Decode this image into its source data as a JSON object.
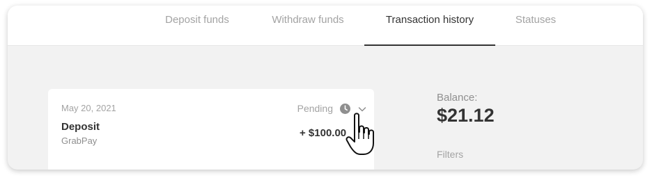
{
  "tabs": [
    {
      "label": "Deposit funds",
      "active": false
    },
    {
      "label": "Withdraw funds",
      "active": false
    },
    {
      "label": "Transaction history",
      "active": true
    },
    {
      "label": "Statuses",
      "active": false
    }
  ],
  "transaction": {
    "date": "May 20, 2021",
    "status": "Pending",
    "status_icon": "clock-icon",
    "expand_icon": "chevron-down-icon",
    "type": "Deposit",
    "method": "GrabPay",
    "amount": "+ $100.00"
  },
  "sidebar": {
    "balance_label": "Balance:",
    "balance_value": "$21.12",
    "filters_label": "Filters"
  },
  "colors": {
    "text_primary": "#333333",
    "text_muted": "#a3a3a3",
    "content_bg": "#f2f2f2",
    "card_bg": "#ffffff"
  }
}
